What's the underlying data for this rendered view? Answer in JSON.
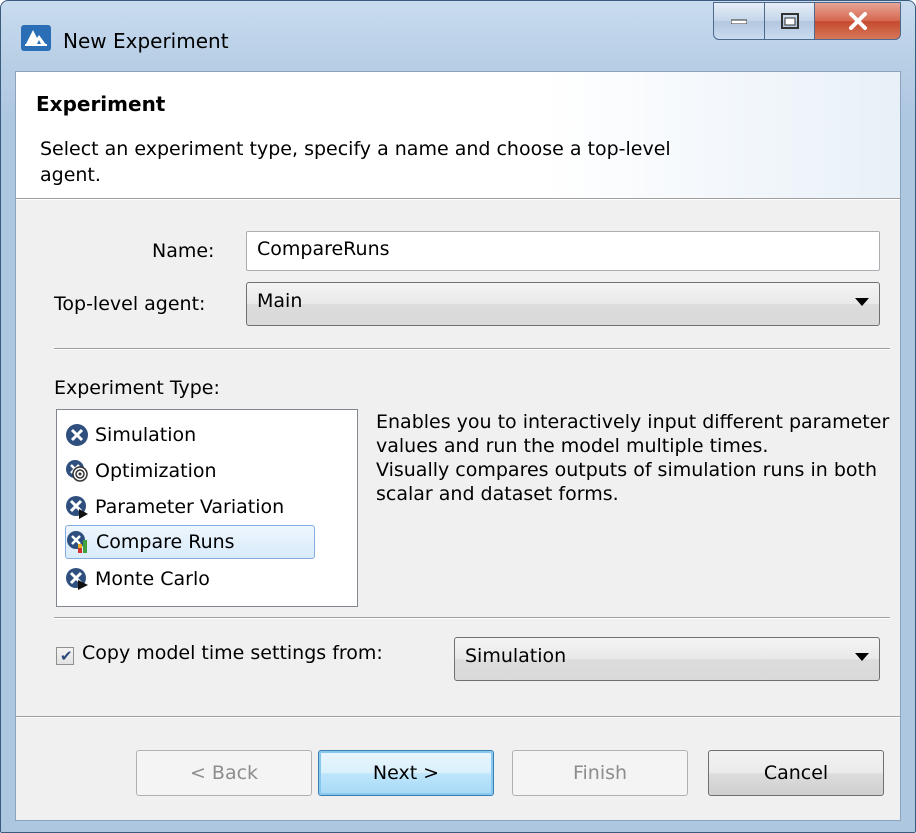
{
  "window": {
    "title": "New Experiment"
  },
  "header": {
    "title": "Experiment",
    "description": "Select an experiment type, specify a name and choose a top-level agent."
  },
  "form": {
    "name_label": "Name:",
    "name_value": "CompareRuns",
    "agent_label": "Top-level agent:",
    "agent_value": "Main"
  },
  "experiment_type": {
    "label": "Experiment Type:",
    "items": [
      {
        "label": "Simulation",
        "icon": "simulation-icon"
      },
      {
        "label": "Optimization",
        "icon": "optimization-icon"
      },
      {
        "label": "Parameter Variation",
        "icon": "parameter-variation-icon"
      },
      {
        "label": "Compare Runs",
        "icon": "compare-runs-icon",
        "selected": true
      },
      {
        "label": "Monte Carlo",
        "icon": "monte-carlo-icon"
      }
    ],
    "description_line1": "Enables you to interactively input different parameter values and run the model multiple times.",
    "description_line2": "Visually compares outputs of simulation runs in both scalar and dataset forms."
  },
  "time_settings": {
    "checked": true,
    "label": "Copy model time settings from:",
    "value": "Simulation"
  },
  "buttons": {
    "back": "< Back",
    "next": "Next >",
    "finish": "Finish",
    "cancel": "Cancel"
  },
  "colors": {
    "accent": "#2f4f7f",
    "selection": "#d9ebfb"
  }
}
